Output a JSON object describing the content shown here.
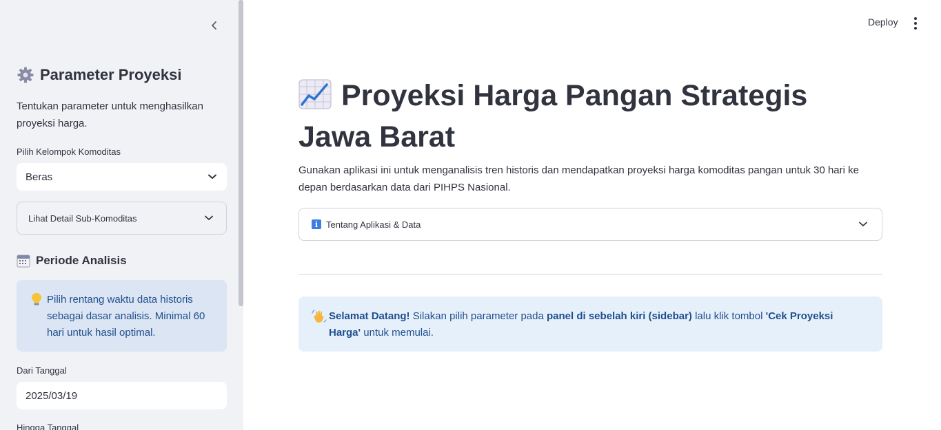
{
  "sidebar": {
    "heading": "Parameter Proyeksi",
    "heading_icon": "gear-icon",
    "description": "Tentukan parameter untuk menghasilkan proyeksi harga.",
    "commodity_label": "Pilih Kelompok Komoditas",
    "commodity_value": "Beras",
    "sub_expander_label": "Lihat Detail Sub-Komoditas",
    "period_heading": "Periode Analisis",
    "period_icon": "calendar-icon",
    "period_info": "Pilih rentang waktu data historis sebagai dasar analisis. Minimal 60 hari untuk hasil optimal.",
    "from_label": "Dari Tanggal",
    "from_value": "2025/03/19",
    "to_label": "Hingga Tanggal"
  },
  "header": {
    "deploy_label": "Deploy"
  },
  "main": {
    "title": "Proyeksi Harga Pangan Strategis Jawa Barat",
    "title_icon": "chart-increasing-icon",
    "description": "Gunakan aplikasi ini untuk menganalisis tren historis dan mendapatkan proyeksi harga komoditas pangan untuk 30 hari ke depan berdasarkan data dari PIHPS Nasional.",
    "about_expander_label": "Tentang Aplikasi & Data",
    "welcome": {
      "bold_greeting": "Selamat Datang!",
      "text_1": " Silakan pilih parameter pada ",
      "bold_panel": "panel di sebelah kiri (sidebar)",
      "text_2": " lalu klik tombol ",
      "bold_button": "'Cek Proyeksi Harga'",
      "text_3": " untuk memulai."
    }
  },
  "colors": {
    "sidebar_bg": "#f0f2f6",
    "info_bg": "#dbe5f3",
    "welcome_bg": "#e6f0fb",
    "info_text": "#1f4e8c"
  }
}
